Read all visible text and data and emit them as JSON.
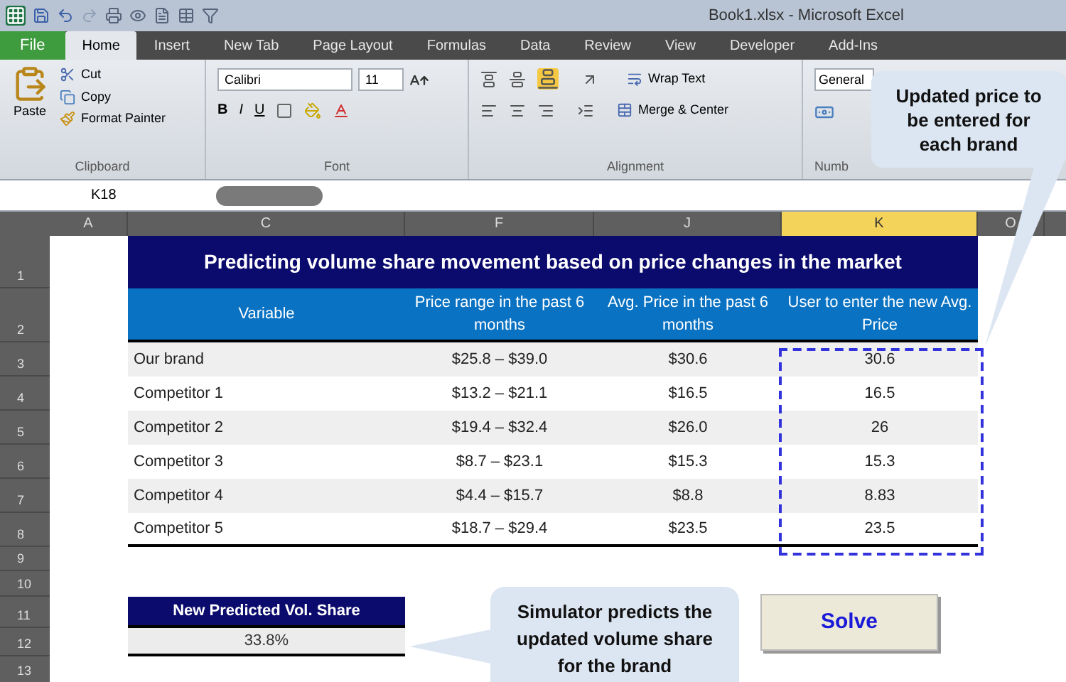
{
  "window": {
    "title": "Book1.xlsx - Microsoft Excel"
  },
  "tabs": [
    {
      "label": "File",
      "kind": "file",
      "selected": false
    },
    {
      "label": "Home",
      "kind": "tab",
      "selected": true
    },
    {
      "label": "Insert",
      "kind": "tab",
      "selected": false
    },
    {
      "label": "New Tab",
      "kind": "tab",
      "selected": false
    },
    {
      "label": "Page Layout",
      "kind": "tab",
      "selected": false
    },
    {
      "label": "Formulas",
      "kind": "tab",
      "selected": false
    },
    {
      "label": "Data",
      "kind": "tab",
      "selected": false
    },
    {
      "label": "Review",
      "kind": "tab",
      "selected": false
    },
    {
      "label": "View",
      "kind": "tab",
      "selected": false
    },
    {
      "label": "Developer",
      "kind": "tab",
      "selected": false
    },
    {
      "label": "Add-Ins",
      "kind": "tab",
      "selected": false
    }
  ],
  "ribbon": {
    "clipboard": {
      "paste": "Paste",
      "cut": "Cut",
      "copy": "Copy",
      "format_painter": "Format Painter",
      "label": "Clipboard"
    },
    "font": {
      "family": "Calibri",
      "size": "11",
      "bold": "B",
      "italic": "I",
      "underline": "U",
      "label": "Font"
    },
    "alignment": {
      "wrap_text": "Wrap Text",
      "merge": "Merge & Center",
      "label": "Alignment"
    },
    "number": {
      "format": "General",
      "label": "Numb"
    }
  },
  "name_box": "K18",
  "columns": [
    {
      "label": "A",
      "selected": false
    },
    {
      "label": "C",
      "selected": false
    },
    {
      "label": "F",
      "selected": false
    },
    {
      "label": "J",
      "selected": false
    },
    {
      "label": "K",
      "selected": true
    },
    {
      "label": "O",
      "selected": false
    }
  ],
  "row_headers": [
    "1",
    "2",
    "3",
    "4",
    "5",
    "6",
    "7",
    "8",
    "9",
    "10",
    "11",
    "12",
    "13"
  ],
  "sheet": {
    "title": "Predicting volume share movement based on price changes in the market",
    "headers": [
      "Variable",
      "Price range in the past 6 months",
      "Avg. Price in the past 6 months",
      "User to enter the new Avg. Price"
    ],
    "rows": [
      [
        "Our brand",
        "$25.8 – $39.0",
        "$30.6",
        "30.6"
      ],
      [
        "Competitor 1",
        "$13.2 – $21.1",
        "$16.5",
        "16.5"
      ],
      [
        "Competitor 2",
        "$19.4 – $32.4",
        "$26.0",
        "26"
      ],
      [
        "Competitor 3",
        "$8.7 – $23.1",
        "$15.3",
        "15.3"
      ],
      [
        "Competitor 4",
        "$4.4 – $15.7",
        "$8.8",
        "8.83"
      ],
      [
        "Competitor 5",
        "$18.7 – $29.4",
        "$23.5",
        "23.5"
      ]
    ],
    "result_label": "New Predicted Vol. Share",
    "result_value": "33.8%",
    "solve": "Solve"
  },
  "callouts": [
    "Updated price to be entered for each brand",
    "Simulator predicts the updated volume share for the brand"
  ]
}
